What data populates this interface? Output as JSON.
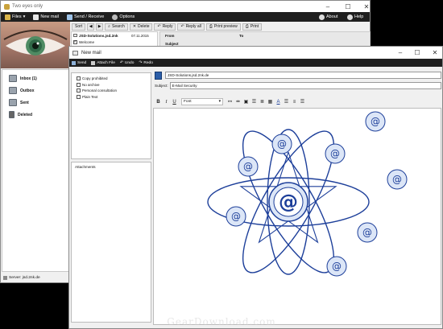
{
  "main_window": {
    "title": "Two eyes only",
    "menu": [
      "Files",
      "New mail",
      "Send / Receive",
      "Options"
    ],
    "about": "About",
    "help": "Help",
    "toolbar": [
      "Sort",
      "Search",
      "Delete",
      "Reply",
      "Reply all",
      "Print preview",
      "Print"
    ],
    "message": {
      "sender": "JSD-Solutions.jsd.2nk",
      "date": "07.11.2015",
      "subject": "Welcome"
    },
    "header_labels": {
      "from": "From",
      "to": "To",
      "subject": "Subject"
    },
    "folders": [
      "Inbox (1)",
      "Outbox",
      "Sent",
      "Deleted"
    ],
    "server": "Server: jsd.2nk.de"
  },
  "new_mail": {
    "title": "New mail",
    "tabs": [
      "Send",
      "Attach File",
      "Undo",
      "Redo"
    ],
    "options": [
      "Copy prohibited",
      "No archive",
      "Personal consultation",
      "Plain Text"
    ],
    "attachments_label": "Attachments",
    "to_value": "JSD-Solutions.jsd.2nk.de",
    "subject_label": "Subject:",
    "subject_value": "E-Mail Security",
    "font_label": "Font"
  },
  "watermark": "GearDownload.com",
  "colors": {
    "menubar": "#1f1f1f",
    "accent": "#1d3f9a",
    "orb_light": "#dce6f7"
  }
}
